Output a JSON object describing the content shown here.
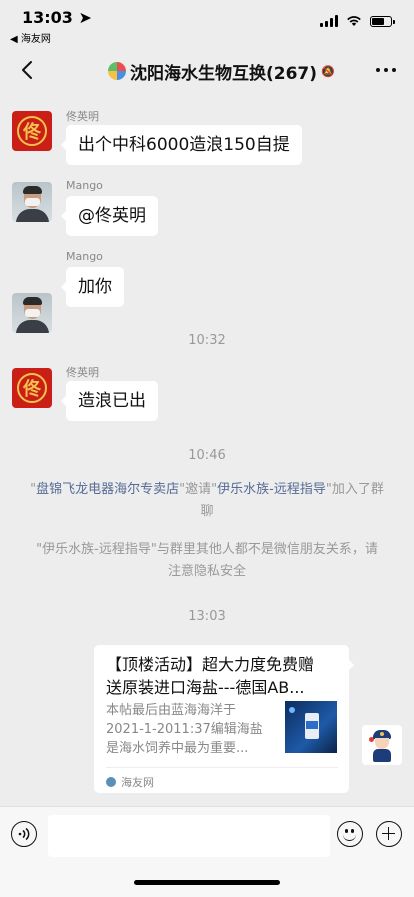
{
  "status_bar": {
    "time": "13:03",
    "back_app": "◀ 海友网"
  },
  "nav": {
    "title": "沈阳海水生物互换(267)",
    "mute_glyph": "🔕"
  },
  "messages": [
    {
      "sender": "佟英明",
      "text": "出个中科6000造浪150自提"
    },
    {
      "sender": "Mango",
      "text": "@佟英明"
    },
    {
      "sender": "Mango",
      "text": "加你"
    },
    {
      "sender": "佟英明",
      "text": "造浪已出"
    }
  ],
  "avatars": {
    "red_char": "佟"
  },
  "timestamps": [
    "10:32",
    "10:46",
    "13:03"
  ],
  "system_notices": {
    "join": {
      "q1": "\"",
      "inviter": "盘锦飞龙电器海尔专卖店",
      "mid": "\"邀请\"",
      "invitee": "伊乐水族-远程指导",
      "end": "\"加入了群聊"
    },
    "privacy": "\"伊乐水族-远程指导\"与群里其他人都不是微信朋友关系，请注意隐私安全"
  },
  "link_card": {
    "title_line1": "【顶楼活动】超大力度免费赠",
    "title_line2": "送原装进口海盐---德国AB...",
    "desc_line1": "本帖最后由蓝海海洋于",
    "desc_line2": "2021-1-2011:37编辑海盐",
    "desc_line3": "是海水饲养中最为重要...",
    "source": "海友网"
  },
  "colors": {
    "link": "#576b95",
    "background": "#ededed"
  }
}
